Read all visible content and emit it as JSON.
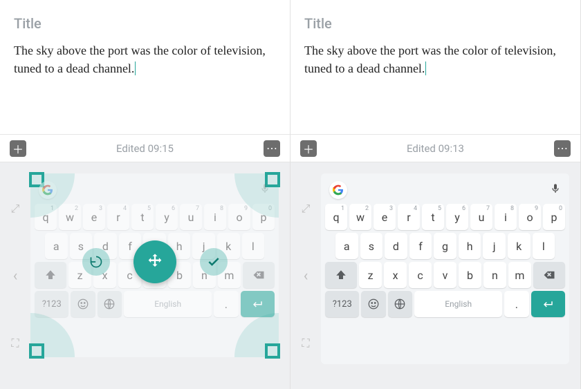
{
  "title_label": "Title",
  "body_text": "The sky above the port was the color of television, tuned to a dead channel.",
  "left": {
    "edited": "Edited 09:15"
  },
  "right": {
    "edited": "Edited 09:13"
  },
  "keyboard": {
    "row1": [
      {
        "k": "q",
        "h": "1"
      },
      {
        "k": "w",
        "h": "2"
      },
      {
        "k": "e",
        "h": "3"
      },
      {
        "k": "r",
        "h": "4"
      },
      {
        "k": "t",
        "h": "5"
      },
      {
        "k": "y",
        "h": "6"
      },
      {
        "k": "u",
        "h": "7"
      },
      {
        "k": "i",
        "h": "8"
      },
      {
        "k": "o",
        "h": "9"
      },
      {
        "k": "p",
        "h": "0"
      }
    ],
    "row2": [
      "a",
      "s",
      "d",
      "f",
      "g",
      "h",
      "j",
      "k",
      "l"
    ],
    "row3": [
      "z",
      "x",
      "c",
      "v",
      "b",
      "n",
      "m"
    ],
    "sym_key": "?123",
    "space_label": "English",
    "period_key": "."
  }
}
